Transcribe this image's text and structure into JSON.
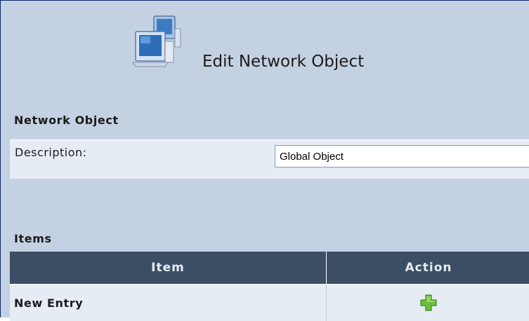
{
  "header": {
    "title": "Edit Network Object",
    "icon": "network-computers-icon"
  },
  "network_object": {
    "section_title": "Network Object",
    "description_label": "Description:",
    "description_value": "Global Object"
  },
  "items": {
    "section_title": "Items",
    "columns": [
      "Item",
      "Action"
    ],
    "rows": [
      {
        "label": "New Entry",
        "action_icon": "add-icon"
      }
    ]
  },
  "colors": {
    "panel_bg": "#c4d1e2",
    "row_bg": "#e6ecf4",
    "header_bg": "#3c4e64",
    "add_icon": "#6cbf3a"
  }
}
